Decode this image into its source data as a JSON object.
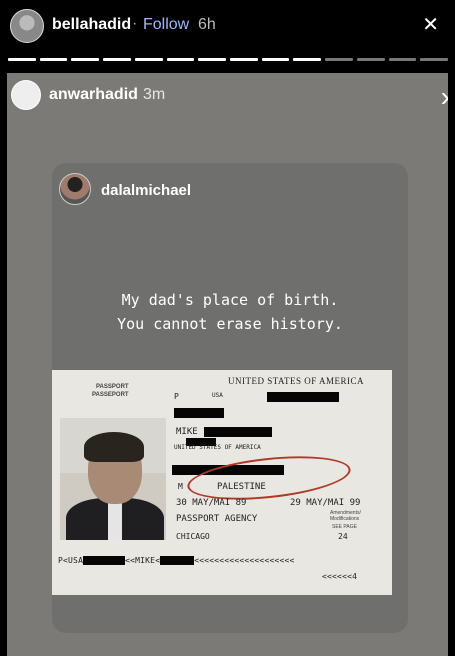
{
  "outer": {
    "username": "bellahadid",
    "separator": "·",
    "follow_label": "Follow",
    "time": "6h",
    "close_icon": "close-icon"
  },
  "story": {
    "username": "anwarhadid",
    "time": "3m",
    "next_icon": "chevron-right-icon",
    "post": {
      "username": "dalalmichael",
      "quote_line1": "My dad's place of birth.",
      "quote_line2": "You cannot erase history."
    },
    "passport": {
      "header_left_1": "PASSPORT",
      "header_left_2": "PASSEPORT",
      "country_title": "UNITED STATES OF AMERICA",
      "type": "P",
      "code": "USA",
      "given_name": "MIKE",
      "nationality": "UNITED STATES OF AMERICA",
      "sex": "M",
      "birthplace": "PALESTINE",
      "issue_date": "30 MAY/MAI 89",
      "expiry_date": "29 MAY/MAI 99",
      "authority": "PASSPORT AGENCY",
      "city": "CHICAGO",
      "see_page_label": "SEE PAGE",
      "see_page_value": "24",
      "amendments_label": "Amendments/ Modifications",
      "mrz_line1": "P<USA",
      "mrz_line1b": "<<MIKE<",
      "mrz_line1c": "<<<<<<<<<<<<<<<<<<<<",
      "mrz_line2_end": "<<<<<<4"
    }
  }
}
